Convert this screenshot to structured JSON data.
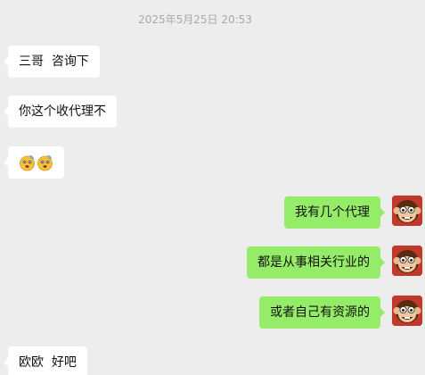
{
  "timestamp": "2025年5月25日 20:53",
  "messages": {
    "m1": "三哥  咨询下",
    "m2": "你这个收代理不",
    "m3_emoji": [
      "dizzy-face-emoji",
      "dizzy-face-emoji"
    ],
    "m4": "我有几个代理",
    "m5": "都是从事相关行业的",
    "m6": "或者自己有资源的",
    "m7": "欧欧  好吧"
  },
  "colors": {
    "background": "#ededed",
    "incoming_bubble": "#ffffff",
    "outgoing_bubble": "#95ec69",
    "timestamp_text": "#a8a8a8"
  },
  "avatar": {
    "icon": "monkey-avatar-icon"
  }
}
